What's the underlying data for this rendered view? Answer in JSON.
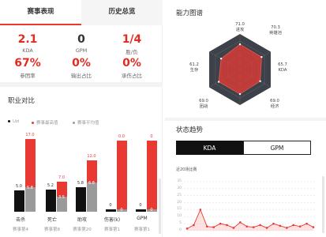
{
  "tabs": [
    {
      "label": "赛事表现",
      "active": true
    },
    {
      "label": "历史总览",
      "active": false
    }
  ],
  "stats": [
    {
      "value": "2.1",
      "label": "KDA",
      "color": "#e22c22"
    },
    {
      "value": "0",
      "label": "GPM",
      "color": "#333333"
    },
    {
      "value": "1/4",
      "label": "胜/负",
      "color": "#e22c22"
    },
    {
      "value": "67%",
      "label": "参团率",
      "color": "#e22c22"
    },
    {
      "value": "0%",
      "label": "输出占比",
      "color": "#e22c22"
    },
    {
      "value": "0%",
      "label": "承伤占比",
      "color": "#e22c22"
    }
  ],
  "duty": {
    "title": "职业对比",
    "legend": [
      {
        "label": "Uzi",
        "color": "#111111"
      },
      {
        "label": "赛事最高值",
        "color": "#e83a33"
      },
      {
        "label": "赛事平均值",
        "color": "#9a9a9a"
      }
    ]
  },
  "chart_data": [
    {
      "type": "bar",
      "title": "职业对比",
      "categories": [
        "击杀",
        "死亡",
        "助攻",
        "伤害(k)",
        "GPM"
      ],
      "series": [
        {
          "name": "Uzi",
          "values": [
            5.0,
            5.2,
            5.8,
            0,
            0
          ]
        },
        {
          "name": "赛事最高值",
          "values": [
            17.0,
            7.0,
            12.0,
            0.0,
            0
          ]
        },
        {
          "name": "赛事平均值",
          "values": [
            5.8,
            3.5,
            6.8,
            0,
            0
          ]
        }
      ],
      "value_labels": {
        "Uzi": [
          "5.0",
          "5.2",
          "5.8",
          "0",
          "0"
        ],
        "赛事最高值": [
          "17.0",
          "7.0",
          "12.0",
          "0.0",
          "0"
        ],
        "赛事平均值": [
          "5.8",
          "3.5",
          "6.8",
          "0",
          "0"
        ]
      },
      "match_labels": [
        "赛事第4",
        "赛事第8",
        "赛事第20",
        "赛事第1",
        "赛事第1"
      ]
    },
    {
      "type": "radar",
      "title": "能力图谱",
      "axes": [
        "进攻",
        "英雄池",
        "KDA",
        "经济",
        "团战",
        "生存"
      ],
      "values": [
        71.0,
        70.3,
        65.7,
        69.0,
        69.0,
        61.2
      ],
      "value_labels": [
        "71.0",
        "70.3",
        "65.7",
        "69.0",
        "69.0",
        "61.2"
      ],
      "range": [
        0,
        100
      ]
    },
    {
      "type": "line",
      "title": "状态趋势",
      "subtitle": "近20场比赛",
      "y_ticks": [
        0,
        5,
        10,
        15,
        20,
        25,
        30,
        35
      ],
      "ylim": [
        0,
        35
      ],
      "values": [
        1.5,
        4,
        15,
        3,
        2.5,
        5,
        4,
        2,
        6,
        3,
        2.5,
        4,
        2,
        5,
        3.5,
        2,
        4,
        3,
        5,
        2.5
      ],
      "grid": true
    }
  ],
  "radar_title": "能力图谱",
  "trend": {
    "title": "状态趋势",
    "toggle": [
      "KDA",
      "GPM"
    ],
    "active": "KDA",
    "note": "近20场比赛"
  },
  "colors": {
    "accent": "#e83a33",
    "dark": "#111111",
    "grey": "#9a9a9a",
    "radar_bg": "#3d4149"
  }
}
